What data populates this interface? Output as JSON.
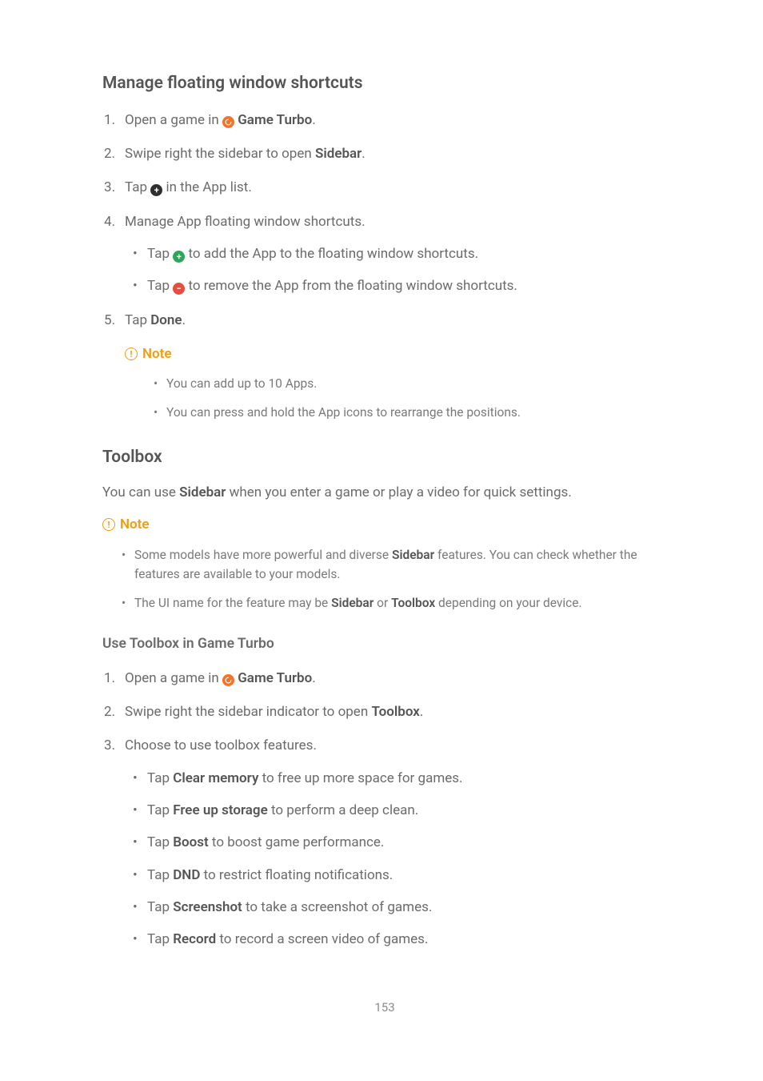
{
  "section1": {
    "heading": "Manage floating window shortcuts",
    "steps": {
      "s1_a": "Open a game in ",
      "s1_b": "Game Turbo",
      "s1_c": ".",
      "s2_a": "Swipe right the sidebar to open ",
      "s2_b": "Sidebar",
      "s2_c": ".",
      "s3_a": "Tap ",
      "s3_b": " in the App list.",
      "s4": "Manage App floating window shortcuts.",
      "s4_sub1_a": "Tap ",
      "s4_sub1_b": " to add the App to the floating window shortcuts.",
      "s4_sub2_a": "Tap ",
      "s4_sub2_b": " to remove the App from the floating window shortcuts.",
      "s5_a": "Tap ",
      "s5_b": "Done",
      "s5_c": "."
    },
    "note": {
      "label": "Note",
      "items": {
        "n1": "You can add up to 10 Apps.",
        "n2": "You can press and hold the App icons to rearrange the positions."
      }
    }
  },
  "section2": {
    "heading": "Toolbox",
    "intro_a": "You can use ",
    "intro_b": "Sidebar",
    "intro_c": " when you enter a game or play a video for quick settings.",
    "note": {
      "label": "Note",
      "items": {
        "n1_a": "Some models have more powerful and diverse ",
        "n1_b": "Sidebar",
        "n1_c": " features. You can check whether the features are available to your models.",
        "n2_a": "The UI name for the feature may be ",
        "n2_b": "Sidebar",
        "n2_c": " or ",
        "n2_d": "Toolbox",
        "n2_e": " depending on your device."
      }
    }
  },
  "section3": {
    "heading": "Use Toolbox in Game Turbo",
    "steps": {
      "s1_a": "Open a game in ",
      "s1_b": "Game Turbo",
      "s1_c": ".",
      "s2_a": "Swipe right the sidebar indicator to open ",
      "s2_b": "Toolbox",
      "s2_c": ".",
      "s3": "Choose to use toolbox features.",
      "s3_sub": {
        "a1_a": "Tap ",
        "a1_b": "Clear memory",
        "a1_c": " to free up more space for games.",
        "a2_a": "Tap ",
        "a2_b": "Free up storage",
        "a2_c": " to perform a deep clean.",
        "a3_a": "Tap ",
        "a3_b": "Boost",
        "a3_c": " to boost game performance.",
        "a4_a": "Tap ",
        "a4_b": "DND",
        "a4_c": " to restrict floating notifications.",
        "a5_a": "Tap ",
        "a5_b": "Screenshot",
        "a5_c": " to take a screenshot of games.",
        "a6_a": "Tap ",
        "a6_b": "Record",
        "a6_c": " to record a screen video of games."
      }
    }
  },
  "pageNumber": "153",
  "icons": {
    "gameTurbo": "game-turbo-icon",
    "plusDark": "plus-dark-icon",
    "plusGreen": "plus-green-icon",
    "minusRed": "minus-red-icon",
    "info": "info-icon"
  }
}
